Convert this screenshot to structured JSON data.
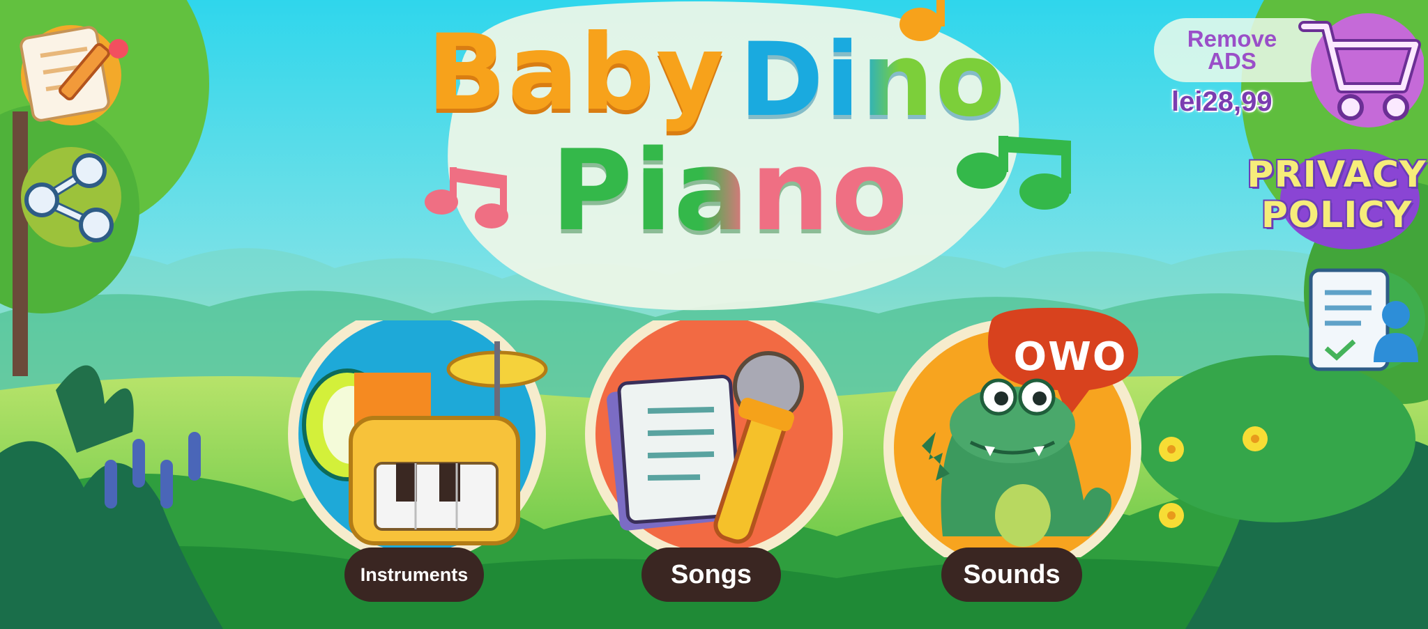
{
  "title": {
    "line1_word1": "Baby",
    "line1_word2": "Dino",
    "line2": "Piano"
  },
  "purchase": {
    "remove_ads_line1": "Remove",
    "remove_ads_line2": "ADS",
    "price": "lei28,99"
  },
  "privacy": {
    "line1": "PRIVACY",
    "line2": "POLICY"
  },
  "modes": [
    {
      "label": "Instruments"
    },
    {
      "label": "Songs"
    },
    {
      "label": "Sounds"
    }
  ],
  "speech_bubble": "OWO",
  "colors": {
    "sky_top": "#34d9ec",
    "sky_bottom": "#bff1d8",
    "grass": "#38b24a",
    "title_orange": "#f7a21b",
    "title_blue": "#1aaadf",
    "title_green": "#34b84a",
    "title_pink": "#ef6f83",
    "purple": "#9a4fc8",
    "label_bg": "#3a2622"
  },
  "icons": {
    "edit": "note-pencil-icon",
    "share": "share-icon",
    "cart": "shopping-cart-icon",
    "account": "user-document-icon"
  }
}
